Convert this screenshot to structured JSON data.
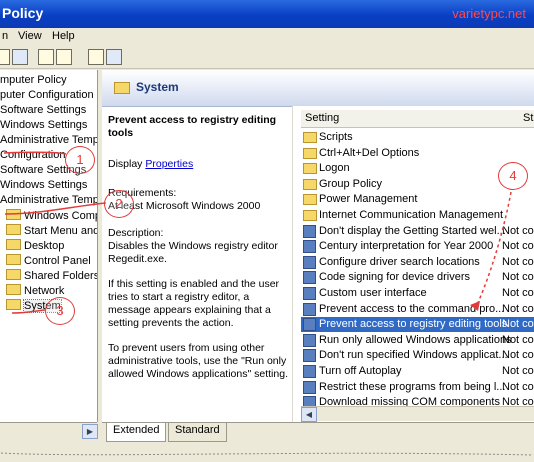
{
  "window": {
    "title": "Policy",
    "watermark": "varietypc.net"
  },
  "menu": [
    "n",
    "View",
    "Help"
  ],
  "tree": {
    "items": [
      "mputer Policy",
      "puter Configuration",
      "Software Settings",
      "Windows Settings",
      "Administrative Templa",
      "Configuration",
      "Software Settings",
      "Windows Settings",
      "Administrative Templat",
      "Windows Compone",
      "Start Menu and Tas",
      "Desktop",
      "Control Panel",
      "Shared Folders",
      "Network",
      "System"
    ]
  },
  "header": {
    "title": "System"
  },
  "description": {
    "title": "Prevent access to registry editing tools",
    "display_label": "Display",
    "display_link": "Properties",
    "requirements_label": "Requirements:",
    "requirements": "At least Microsoft Windows 2000",
    "description_label": "Description:",
    "description": "Disables the Windows registry editor Regedit.exe.",
    "para1": "If this setting is enabled and the user tries to start a registry editor, a message appears explaining that a setting prevents the action.",
    "para2": "To prevent users from using other administrative tools, use the \"Run only allowed Windows applications\" setting."
  },
  "list": {
    "col_setting": "Setting",
    "col_state": "St",
    "rows": [
      {
        "name": "Scripts",
        "state": "",
        "type": "folder"
      },
      {
        "name": "Ctrl+Alt+Del Options",
        "state": "",
        "type": "folder"
      },
      {
        "name": "Logon",
        "state": "",
        "type": "folder"
      },
      {
        "name": "Group Policy",
        "state": "",
        "type": "folder"
      },
      {
        "name": "Power Management",
        "state": "",
        "type": "folder"
      },
      {
        "name": "Internet Communication Management",
        "state": "",
        "type": "folder"
      },
      {
        "name": "Don't display the Getting Started wel...",
        "state": "Not cor",
        "type": "setting"
      },
      {
        "name": "Century interpretation for Year 2000",
        "state": "Not cor",
        "type": "setting"
      },
      {
        "name": "Configure driver search locations",
        "state": "Not cor",
        "type": "setting"
      },
      {
        "name": "Code signing for device drivers",
        "state": "Not cor",
        "type": "setting"
      },
      {
        "name": "Custom user interface",
        "state": "Not cor",
        "type": "setting"
      },
      {
        "name": "Prevent access to the command pro...",
        "state": "Not cor",
        "type": "setting"
      },
      {
        "name": "Prevent access to registry editing tools",
        "state": "Not cor",
        "type": "setting",
        "selected": true
      },
      {
        "name": "Run only allowed Windows applications",
        "state": "Not cor",
        "type": "setting"
      },
      {
        "name": "Don't run specified Windows applicat...",
        "state": "Not cor",
        "type": "setting"
      },
      {
        "name": "Turn off Autoplay",
        "state": "Not cor",
        "type": "setting"
      },
      {
        "name": "Restrict these programs from being l...",
        "state": "Not cor",
        "type": "setting"
      },
      {
        "name": "Download missing COM components",
        "state": "Not cor",
        "type": "setting"
      }
    ]
  },
  "tabs": [
    "Extended",
    "Standard"
  ],
  "callouts": [
    "1",
    "2",
    "3",
    "4"
  ],
  "colors": {
    "title_bar": "#0a3fc4",
    "selection": "#316ac5",
    "callout": "#e23b3b",
    "link": "#0000cc"
  }
}
